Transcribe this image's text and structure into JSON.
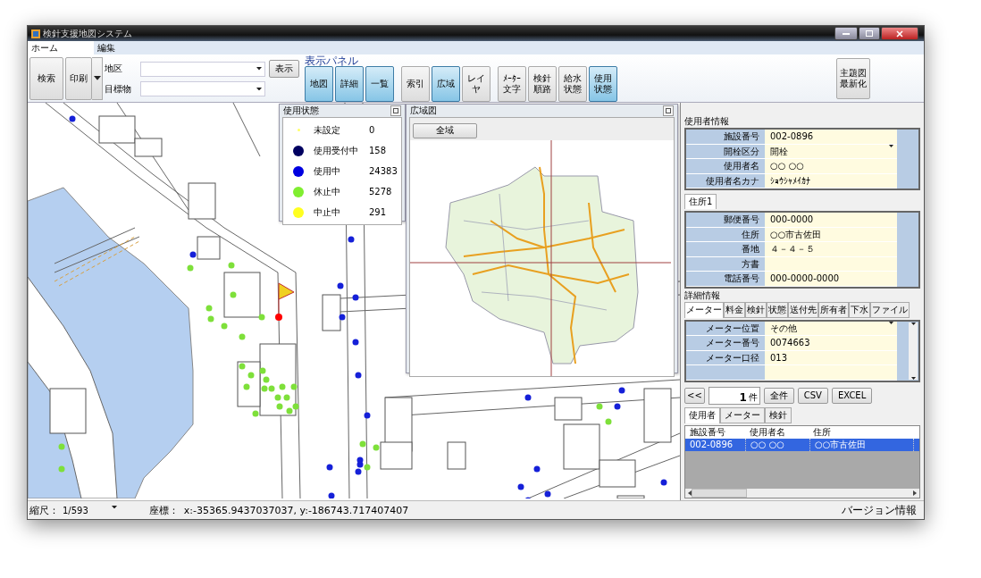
{
  "window": {
    "title": "検針支援地図システム"
  },
  "menu": [
    {
      "label": "ホーム",
      "selected": true
    },
    {
      "label": "編集",
      "selected": false
    }
  ],
  "ribbon": {
    "search_button": "検索",
    "print_button": "印刷",
    "fields": [
      {
        "label": "地区"
      },
      {
        "label": "目標物"
      }
    ],
    "show_button": "表示",
    "panel_group_label": "表示パネル",
    "toggles": [
      {
        "label": "地図",
        "selected": true
      },
      {
        "label": "詳細",
        "selected": true
      },
      {
        "label": "一覧",
        "selected": true
      },
      {
        "label": "索引",
        "selected": false
      },
      {
        "label": "広域",
        "selected": true
      },
      {
        "label": "レイヤ",
        "selected": false
      },
      {
        "label": "ﾒｰﾀｰ文字",
        "selected": false
      },
      {
        "label": "検針順路",
        "selected": false
      },
      {
        "label": "給水状態",
        "selected": false
      },
      {
        "label": "使用状態",
        "selected": true
      }
    ],
    "refresh_button": "主題図最新化"
  },
  "legend_panel": {
    "title": "使用状態",
    "items": [
      {
        "label": "未設定",
        "count": "0",
        "color": "#ffff66",
        "kind": "point"
      },
      {
        "label": "使用受付中",
        "count": "158",
        "color": "#000060",
        "kind": "dot"
      },
      {
        "label": "使用中",
        "count": "24383",
        "color": "#0000e0",
        "kind": "dot"
      },
      {
        "label": "休止中",
        "count": "5278",
        "color": "#80ee30",
        "kind": "dot"
      },
      {
        "label": "中止中",
        "count": "291",
        "color": "#ffff20",
        "kind": "dot"
      }
    ]
  },
  "overview_panel": {
    "title": "広域図",
    "button": "全域"
  },
  "user_info": {
    "title": "使用者情報",
    "fields": [
      {
        "label": "施設番号",
        "value": "002-0896",
        "kind": "text"
      },
      {
        "label": "開栓区分",
        "value": "開栓",
        "kind": "select"
      },
      {
        "label": "使用者名",
        "value": "○○ ○○",
        "kind": "text"
      },
      {
        "label": "使用者名カナ",
        "value": "ｼｮｳｼｬﾒｲｶﾅ",
        "kind": "text"
      }
    ]
  },
  "address_tabs": [
    {
      "label": "住所1",
      "selected": true
    }
  ],
  "address_fields": [
    {
      "label": "郵便番号",
      "value": "000-0000",
      "kind": "text"
    },
    {
      "label": "住所",
      "value": "○○市古佐田",
      "kind": "text"
    },
    {
      "label": "番地",
      "value": "４－４－５",
      "kind": "text"
    },
    {
      "label": "方書",
      "kind": "text"
    },
    {
      "label": "電話番号",
      "value": "000-0000-0000",
      "kind": "text"
    }
  ],
  "detail": {
    "title": "詳細情報",
    "tabs": [
      {
        "label": "メーター",
        "selected": true
      },
      {
        "label": "料金",
        "selected": false
      },
      {
        "label": "検針",
        "selected": false
      },
      {
        "label": "状態",
        "selected": false
      },
      {
        "label": "送付先",
        "selected": false
      },
      {
        "label": "所有者",
        "selected": false
      },
      {
        "label": "下水",
        "selected": false
      },
      {
        "label": "ファイル",
        "selected": false
      }
    ],
    "fields": [
      {
        "label": "メーター位置",
        "value": "その他",
        "kind": "select"
      },
      {
        "label": "メーター番号",
        "value": "0074663",
        "kind": "text"
      },
      {
        "label": "メーター口径",
        "value": "013",
        "kind": "text"
      }
    ]
  },
  "pager": {
    "back_button": "<<",
    "count": "1",
    "unit": "件",
    "buttons": [
      "全件",
      "CSV",
      "EXCEL"
    ]
  },
  "list_tabs": [
    {
      "label": "使用者",
      "selected": true
    },
    {
      "label": "メーター",
      "selected": false
    },
    {
      "label": "検針",
      "selected": false
    }
  ],
  "table": {
    "columns": [
      "施設番号",
      "使用者名",
      "住所"
    ],
    "rows": [
      {
        "cells": [
          "002-0896",
          "○○ ○○",
          "○○市古佐田"
        ],
        "selected": true
      }
    ]
  },
  "status_bar": {
    "scale_label": "縮尺：",
    "scale_value": "1/593",
    "coord_label": "座標：",
    "coords": "x:-35365.9437037037, y:-186743.717407407",
    "version": "バージョン情報"
  }
}
